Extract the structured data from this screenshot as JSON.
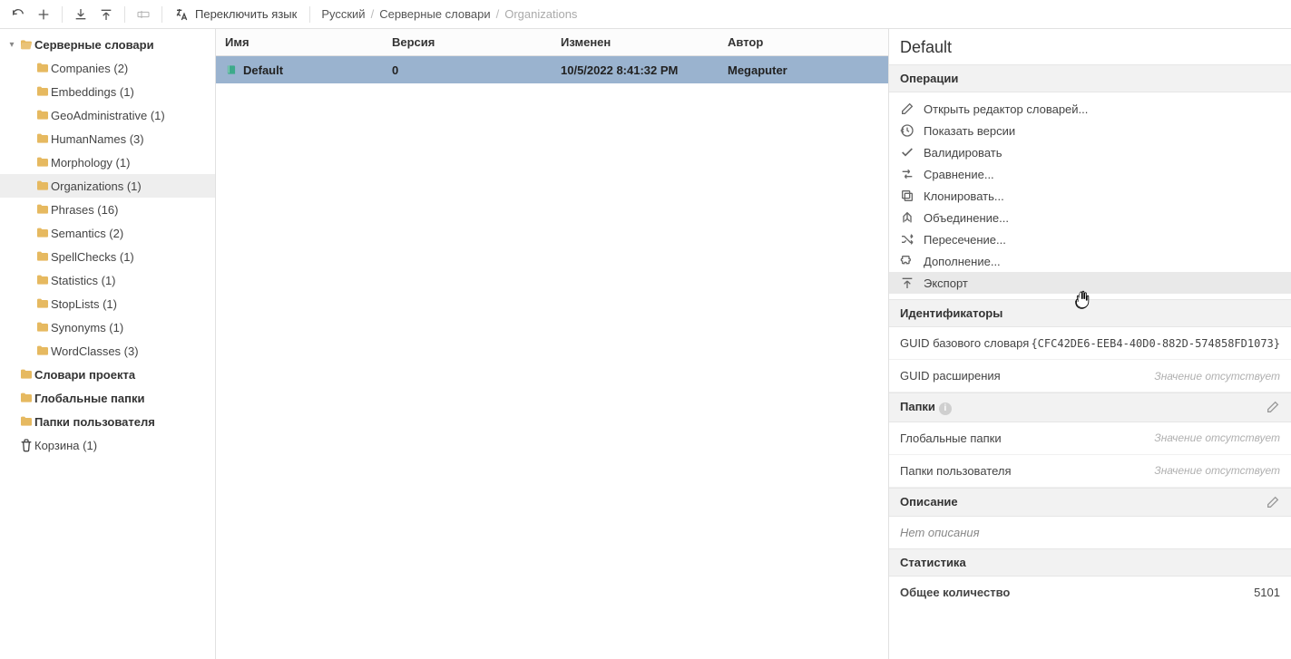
{
  "toolbar": {
    "switch_language_label": "Переключить язык"
  },
  "breadcrumb": {
    "root": "Русский",
    "parent": "Серверные словари",
    "current": "Organizations"
  },
  "sidebar": {
    "root_label": "Серверные словари",
    "items": [
      {
        "label": "Companies (2)"
      },
      {
        "label": "Embeddings (1)"
      },
      {
        "label": "GeoAdministrative (1)"
      },
      {
        "label": "HumanNames (3)"
      },
      {
        "label": "Morphology (1)"
      },
      {
        "label": "Organizations (1)"
      },
      {
        "label": "Phrases (16)"
      },
      {
        "label": "Semantics (2)"
      },
      {
        "label": "SpellChecks (1)"
      },
      {
        "label": "Statistics (1)"
      },
      {
        "label": "StopLists (1)"
      },
      {
        "label": "Synonyms (1)"
      },
      {
        "label": "WordClasses (3)"
      }
    ],
    "extra": [
      {
        "label": "Словари проекта"
      },
      {
        "label": "Глобальные папки"
      },
      {
        "label": "Папки пользователя"
      }
    ],
    "trash_label": "Корзина (1)"
  },
  "grid": {
    "headers": {
      "name": "Имя",
      "version": "Версия",
      "modified": "Изменен",
      "author": "Автор"
    },
    "rows": [
      {
        "name": "Default",
        "version": "0",
        "modified": "10/5/2022 8:41:32 PM",
        "author": "Megaputer"
      }
    ]
  },
  "details": {
    "title": "Default",
    "operations_header": "Операции",
    "operations": [
      {
        "label": "Открыть редактор словарей...",
        "icon": "pencil"
      },
      {
        "label": "Показать версии",
        "icon": "history"
      },
      {
        "label": "Валидировать",
        "icon": "check"
      },
      {
        "label": "Сравнение...",
        "icon": "compare"
      },
      {
        "label": "Клонировать...",
        "icon": "copy"
      },
      {
        "label": "Объединение...",
        "icon": "merge"
      },
      {
        "label": "Пересечение...",
        "icon": "shuffle"
      },
      {
        "label": "Дополнение...",
        "icon": "puzzle"
      },
      {
        "label": "Экспорт",
        "icon": "upload"
      }
    ],
    "ids_header": "Идентификаторы",
    "ids": {
      "base_guid_label": "GUID базового словаря",
      "base_guid_value": "{CFC42DE6-EEB4-40D0-882D-574858FD1073}",
      "ext_guid_label": "GUID расширения",
      "ext_guid_value": "Значение отсутствует"
    },
    "folders_header": "Папки",
    "folders": {
      "global_label": "Глобальные папки",
      "global_value": "Значение отсутствует",
      "user_label": "Папки пользователя",
      "user_value": "Значение отсутствует"
    },
    "desc_header": "Описание",
    "no_description": "Нет описания",
    "stats_header": "Статистика",
    "stats": {
      "total_label": "Общее количество",
      "total_value": "5101"
    }
  }
}
